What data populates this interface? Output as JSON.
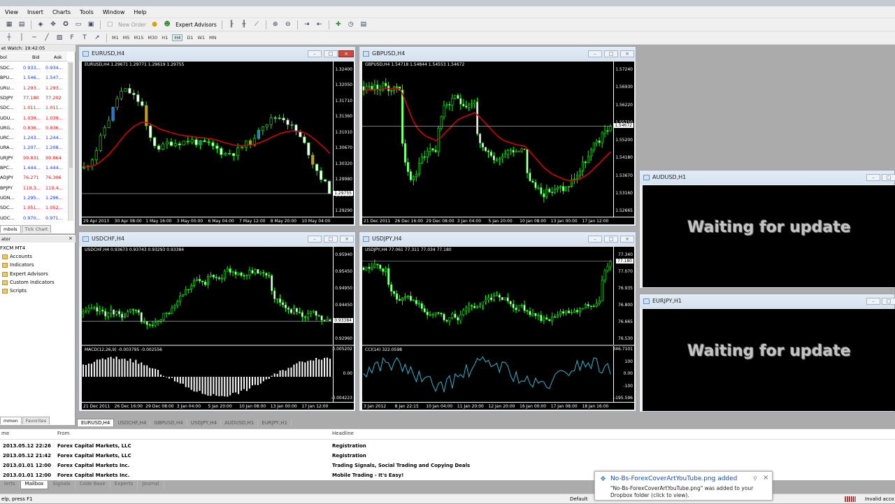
{
  "menu": [
    "View",
    "Insert",
    "Charts",
    "Tools",
    "Window",
    "Help"
  ],
  "toolbar": {
    "expert_advisors": "Expert Advisors",
    "new_order": "New Order",
    "timeframes": [
      "M1",
      "M5",
      "M15",
      "M30",
      "H1",
      "H4",
      "D1",
      "W1",
      "MN"
    ]
  },
  "market_watch": {
    "title": "et Watch: 19:42:05",
    "col_symbol": "bol",
    "col_bid": "Bid",
    "col_ask": "Ask",
    "rows": [
      {
        "s": "SDC...",
        "b": "0.933...",
        "a": "0.934...",
        "c": "blue"
      },
      {
        "s": "BPU...",
        "b": "1.546...",
        "a": "1.547...",
        "c": "blue"
      },
      {
        "s": "URU...",
        "b": "1.293...",
        "a": "1.293...",
        "c": "red"
      },
      {
        "s": "SDJPY",
        "b": "77.180",
        "a": "77.202",
        "c": "red"
      },
      {
        "s": "SDC...",
        "b": "1.011...",
        "a": "1.011...",
        "c": "red"
      },
      {
        "s": "UDU...",
        "b": "1.039...",
        "a": "1.039...",
        "c": "red"
      },
      {
        "s": "URG...",
        "b": "0.836...",
        "a": "0.836...",
        "c": "red"
      },
      {
        "s": "URC...",
        "b": "1.243...",
        "a": "1.244...",
        "c": "blue"
      },
      {
        "s": "URA...",
        "b": "1.207...",
        "a": "1.208...",
        "c": "blue"
      },
      {
        "s": "URJPY",
        "b": "99.831",
        "a": "99.864",
        "c": "red"
      },
      {
        "s": "BPC...",
        "b": "1.444...",
        "a": "1.444...",
        "c": "blue"
      },
      {
        "s": "ADJPY",
        "b": "76.271",
        "a": "76.306",
        "c": "red"
      },
      {
        "s": "BPJPY",
        "b": "119.3...",
        "a": "119.4...",
        "c": "red"
      },
      {
        "s": "UDN...",
        "b": "1.295...",
        "a": "1.296...",
        "c": "blue"
      },
      {
        "s": "SDC...",
        "b": "1.051...",
        "a": "1.052...",
        "c": "red"
      },
      {
        "s": "UDC...",
        "b": "0.970...",
        "a": "0.971...",
        "c": "blue"
      }
    ],
    "tabs": [
      "mbols",
      "Tick Chart"
    ]
  },
  "navigator": {
    "title": "ator",
    "items": [
      "FXCM MT4",
      "Accounts",
      "Indicators",
      "Expert Advisors",
      "Custom Indicators",
      "Scripts"
    ],
    "tabs": [
      "mmon",
      "Favorites"
    ]
  },
  "charts": [
    {
      "id": "eurusd",
      "title": "EURUSD,H4",
      "label": "EURUSD,H4  1.29671 1.29771 1.29619 1.29755",
      "yticks": [
        "1.32400",
        "1.32050",
        "1.31710",
        "1.31360",
        "1.31010",
        "1.30670",
        "1.30320",
        "1.29980",
        "1.29630",
        "1.29290"
      ],
      "xticks": [
        "29 Apr 2013",
        "30 Apr 08:00",
        "1 May 16:00",
        "3 May 00:00",
        "6 May 04:00",
        "7 May 12:00",
        "8 May 20:00",
        "10 May 04:00"
      ],
      "price": "1.29755"
    },
    {
      "id": "gbpusd",
      "title": "GBPUSD,H4",
      "label": "GBPUSD,H4  1.54718 1.54844 1.54553 1.54672",
      "yticks": [
        "1.57240",
        "1.56930",
        "1.56220",
        "1.55710",
        "1.55200",
        "1.54180",
        "1.53670",
        "1.53160",
        "1.52665"
      ],
      "xticks": [
        "21 Dec 2011",
        "26 Dec 16:00",
        "29 Dec 08:00",
        "3 Jan 04:00",
        "5 Jan 20:00",
        "10 Jan 08:00",
        "13 Jan 00:00",
        "17 Jan 12:00"
      ],
      "price": "1.54672"
    },
    {
      "id": "usdchf",
      "title": "USDCHF,H4",
      "label": "USDCHF,H4  0.93673 0.93743 0.93293 0.93384",
      "yticks": [
        "0.95940",
        "0.95450",
        "0.94950",
        "0.94450",
        "0.93960",
        "0.92960"
      ],
      "xticks": [
        "21 Dec 2011",
        "26 Dec 16:00",
        "29 Dec 08:00",
        "3 Jan 04:00",
        "5 Jan 20:00",
        "10 Jan 08:00",
        "13 Jan 00:00",
        "17 Jan 12:00"
      ],
      "price": "0.93384",
      "sub_label": "MACD(12,26,9) -0.003795 -0.002556",
      "sub_yticks": [
        "0.005202",
        "0.00",
        "-0.004223"
      ]
    },
    {
      "id": "usdjpy",
      "title": "USDJPY,H4",
      "label": "USDJPY,H4  77.061 77.311 77.034 77.180",
      "yticks": [
        "77.340",
        "77.070",
        "76.935",
        "76.800",
        "76.665",
        "76.530"
      ],
      "xticks": [
        "3 Jan 2012",
        "8 Jan 22:15",
        "10 Jan 04:00",
        "11 Jan 20:00",
        "12 Jan 20:00",
        "16 Jan 00:00",
        "17 Jan 08:00",
        "18 Jan 16:00"
      ],
      "price": "77.180",
      "sub_label": "CCI(14) 322.0598",
      "sub_yticks": [
        "346.7101",
        "100",
        "0.00",
        "-100",
        "-195.596"
      ]
    },
    {
      "id": "audusd",
      "title": "AUDUSD,H1",
      "waiting": "Waiting for update"
    },
    {
      "id": "eurjpy",
      "title": "EURJPY,H1",
      "waiting": "Waiting for update"
    }
  ],
  "chart_tabs": [
    "EURUSD,H4",
    "USDCHF,H4",
    "GBPUSD,H4",
    "USDJPY,H4",
    "AUDUSD,H1",
    "EURJPY,H1"
  ],
  "terminal": {
    "headers": [
      "me",
      "From",
      "Headline"
    ],
    "rows": [
      {
        "time": "2013.05.12 22:26",
        "from": "Forex Capital Markets, LLC",
        "headline": "Registration"
      },
      {
        "time": "2013.05.12 21:42",
        "from": "Forex Capital Markets, LLC",
        "headline": "Registration"
      },
      {
        "time": "2013.01.01 12:00",
        "from": "Forex Capital Markets Inc.",
        "headline": "Trading Signals, Social Trading and Copying Deals"
      },
      {
        "time": "2013.01.01 12:00",
        "from": "Forex Capital Markets Inc.",
        "headline": "Mobile Trading - It's Easy!"
      }
    ],
    "tabs": [
      "lerts",
      "Mailbox",
      "Signals",
      "Code Base",
      "Experts",
      "Journal"
    ]
  },
  "status": {
    "left": "elp, press F1",
    "profile": "Default",
    "right": "Invalid acco"
  },
  "toast": {
    "title": "No-Bs-ForexCoverArtYouTube.png added",
    "body": "\"No-Bs-ForexCoverArtYouTube.png\" was added to your Dropbox folder (click to view)."
  },
  "colors": {
    "bull": "#00ff00",
    "bear": "#00a000",
    "ma": "#dd0000",
    "bg": "#000000",
    "macd": "#ffffff",
    "cci": "#3ab0c8"
  }
}
